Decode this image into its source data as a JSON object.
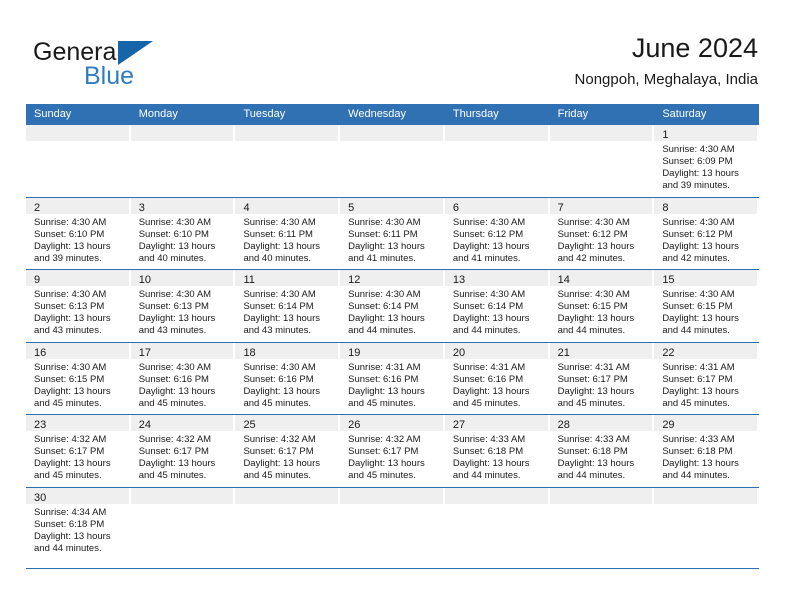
{
  "brand": {
    "name_part1": "General",
    "name_part2": "Blue"
  },
  "header": {
    "title": "June 2024",
    "subtitle": "Nongpoh, Meghalaya, India"
  },
  "colors": {
    "header_blue": "#3071b4",
    "row_divider": "#2f6fad",
    "daynum_band": "#efefef",
    "brand_blue": "#2f7cc0"
  },
  "weekdays": [
    "Sunday",
    "Monday",
    "Tuesday",
    "Wednesday",
    "Thursday",
    "Friday",
    "Saturday"
  ],
  "weeks": [
    [
      {
        "day": "",
        "sunrise": "",
        "sunset": "",
        "daylight1": "",
        "daylight2": ""
      },
      {
        "day": "",
        "sunrise": "",
        "sunset": "",
        "daylight1": "",
        "daylight2": ""
      },
      {
        "day": "",
        "sunrise": "",
        "sunset": "",
        "daylight1": "",
        "daylight2": ""
      },
      {
        "day": "",
        "sunrise": "",
        "sunset": "",
        "daylight1": "",
        "daylight2": ""
      },
      {
        "day": "",
        "sunrise": "",
        "sunset": "",
        "daylight1": "",
        "daylight2": ""
      },
      {
        "day": "",
        "sunrise": "",
        "sunset": "",
        "daylight1": "",
        "daylight2": ""
      },
      {
        "day": "1",
        "sunrise": "Sunrise: 4:30 AM",
        "sunset": "Sunset: 6:09 PM",
        "daylight1": "Daylight: 13 hours",
        "daylight2": "and 39 minutes."
      }
    ],
    [
      {
        "day": "2",
        "sunrise": "Sunrise: 4:30 AM",
        "sunset": "Sunset: 6:10 PM",
        "daylight1": "Daylight: 13 hours",
        "daylight2": "and 39 minutes."
      },
      {
        "day": "3",
        "sunrise": "Sunrise: 4:30 AM",
        "sunset": "Sunset: 6:10 PM",
        "daylight1": "Daylight: 13 hours",
        "daylight2": "and 40 minutes."
      },
      {
        "day": "4",
        "sunrise": "Sunrise: 4:30 AM",
        "sunset": "Sunset: 6:11 PM",
        "daylight1": "Daylight: 13 hours",
        "daylight2": "and 40 minutes."
      },
      {
        "day": "5",
        "sunrise": "Sunrise: 4:30 AM",
        "sunset": "Sunset: 6:11 PM",
        "daylight1": "Daylight: 13 hours",
        "daylight2": "and 41 minutes."
      },
      {
        "day": "6",
        "sunrise": "Sunrise: 4:30 AM",
        "sunset": "Sunset: 6:12 PM",
        "daylight1": "Daylight: 13 hours",
        "daylight2": "and 41 minutes."
      },
      {
        "day": "7",
        "sunrise": "Sunrise: 4:30 AM",
        "sunset": "Sunset: 6:12 PM",
        "daylight1": "Daylight: 13 hours",
        "daylight2": "and 42 minutes."
      },
      {
        "day": "8",
        "sunrise": "Sunrise: 4:30 AM",
        "sunset": "Sunset: 6:12 PM",
        "daylight1": "Daylight: 13 hours",
        "daylight2": "and 42 minutes."
      }
    ],
    [
      {
        "day": "9",
        "sunrise": "Sunrise: 4:30 AM",
        "sunset": "Sunset: 6:13 PM",
        "daylight1": "Daylight: 13 hours",
        "daylight2": "and 43 minutes."
      },
      {
        "day": "10",
        "sunrise": "Sunrise: 4:30 AM",
        "sunset": "Sunset: 6:13 PM",
        "daylight1": "Daylight: 13 hours",
        "daylight2": "and 43 minutes."
      },
      {
        "day": "11",
        "sunrise": "Sunrise: 4:30 AM",
        "sunset": "Sunset: 6:14 PM",
        "daylight1": "Daylight: 13 hours",
        "daylight2": "and 43 minutes."
      },
      {
        "day": "12",
        "sunrise": "Sunrise: 4:30 AM",
        "sunset": "Sunset: 6:14 PM",
        "daylight1": "Daylight: 13 hours",
        "daylight2": "and 44 minutes."
      },
      {
        "day": "13",
        "sunrise": "Sunrise: 4:30 AM",
        "sunset": "Sunset: 6:14 PM",
        "daylight1": "Daylight: 13 hours",
        "daylight2": "and 44 minutes."
      },
      {
        "day": "14",
        "sunrise": "Sunrise: 4:30 AM",
        "sunset": "Sunset: 6:15 PM",
        "daylight1": "Daylight: 13 hours",
        "daylight2": "and 44 minutes."
      },
      {
        "day": "15",
        "sunrise": "Sunrise: 4:30 AM",
        "sunset": "Sunset: 6:15 PM",
        "daylight1": "Daylight: 13 hours",
        "daylight2": "and 44 minutes."
      }
    ],
    [
      {
        "day": "16",
        "sunrise": "Sunrise: 4:30 AM",
        "sunset": "Sunset: 6:15 PM",
        "daylight1": "Daylight: 13 hours",
        "daylight2": "and 45 minutes."
      },
      {
        "day": "17",
        "sunrise": "Sunrise: 4:30 AM",
        "sunset": "Sunset: 6:16 PM",
        "daylight1": "Daylight: 13 hours",
        "daylight2": "and 45 minutes."
      },
      {
        "day": "18",
        "sunrise": "Sunrise: 4:30 AM",
        "sunset": "Sunset: 6:16 PM",
        "daylight1": "Daylight: 13 hours",
        "daylight2": "and 45 minutes."
      },
      {
        "day": "19",
        "sunrise": "Sunrise: 4:31 AM",
        "sunset": "Sunset: 6:16 PM",
        "daylight1": "Daylight: 13 hours",
        "daylight2": "and 45 minutes."
      },
      {
        "day": "20",
        "sunrise": "Sunrise: 4:31 AM",
        "sunset": "Sunset: 6:16 PM",
        "daylight1": "Daylight: 13 hours",
        "daylight2": "and 45 minutes."
      },
      {
        "day": "21",
        "sunrise": "Sunrise: 4:31 AM",
        "sunset": "Sunset: 6:17 PM",
        "daylight1": "Daylight: 13 hours",
        "daylight2": "and 45 minutes."
      },
      {
        "day": "22",
        "sunrise": "Sunrise: 4:31 AM",
        "sunset": "Sunset: 6:17 PM",
        "daylight1": "Daylight: 13 hours",
        "daylight2": "and 45 minutes."
      }
    ],
    [
      {
        "day": "23",
        "sunrise": "Sunrise: 4:32 AM",
        "sunset": "Sunset: 6:17 PM",
        "daylight1": "Daylight: 13 hours",
        "daylight2": "and 45 minutes."
      },
      {
        "day": "24",
        "sunrise": "Sunrise: 4:32 AM",
        "sunset": "Sunset: 6:17 PM",
        "daylight1": "Daylight: 13 hours",
        "daylight2": "and 45 minutes."
      },
      {
        "day": "25",
        "sunrise": "Sunrise: 4:32 AM",
        "sunset": "Sunset: 6:17 PM",
        "daylight1": "Daylight: 13 hours",
        "daylight2": "and 45 minutes."
      },
      {
        "day": "26",
        "sunrise": "Sunrise: 4:32 AM",
        "sunset": "Sunset: 6:17 PM",
        "daylight1": "Daylight: 13 hours",
        "daylight2": "and 45 minutes."
      },
      {
        "day": "27",
        "sunrise": "Sunrise: 4:33 AM",
        "sunset": "Sunset: 6:18 PM",
        "daylight1": "Daylight: 13 hours",
        "daylight2": "and 44 minutes."
      },
      {
        "day": "28",
        "sunrise": "Sunrise: 4:33 AM",
        "sunset": "Sunset: 6:18 PM",
        "daylight1": "Daylight: 13 hours",
        "daylight2": "and 44 minutes."
      },
      {
        "day": "29",
        "sunrise": "Sunrise: 4:33 AM",
        "sunset": "Sunset: 6:18 PM",
        "daylight1": "Daylight: 13 hours",
        "daylight2": "and 44 minutes."
      }
    ],
    [
      {
        "day": "30",
        "sunrise": "Sunrise: 4:34 AM",
        "sunset": "Sunset: 6:18 PM",
        "daylight1": "Daylight: 13 hours",
        "daylight2": "and 44 minutes."
      },
      {
        "day": "",
        "sunrise": "",
        "sunset": "",
        "daylight1": "",
        "daylight2": ""
      },
      {
        "day": "",
        "sunrise": "",
        "sunset": "",
        "daylight1": "",
        "daylight2": ""
      },
      {
        "day": "",
        "sunrise": "",
        "sunset": "",
        "daylight1": "",
        "daylight2": ""
      },
      {
        "day": "",
        "sunrise": "",
        "sunset": "",
        "daylight1": "",
        "daylight2": ""
      },
      {
        "day": "",
        "sunrise": "",
        "sunset": "",
        "daylight1": "",
        "daylight2": ""
      },
      {
        "day": "",
        "sunrise": "",
        "sunset": "",
        "daylight1": "",
        "daylight2": ""
      }
    ]
  ]
}
